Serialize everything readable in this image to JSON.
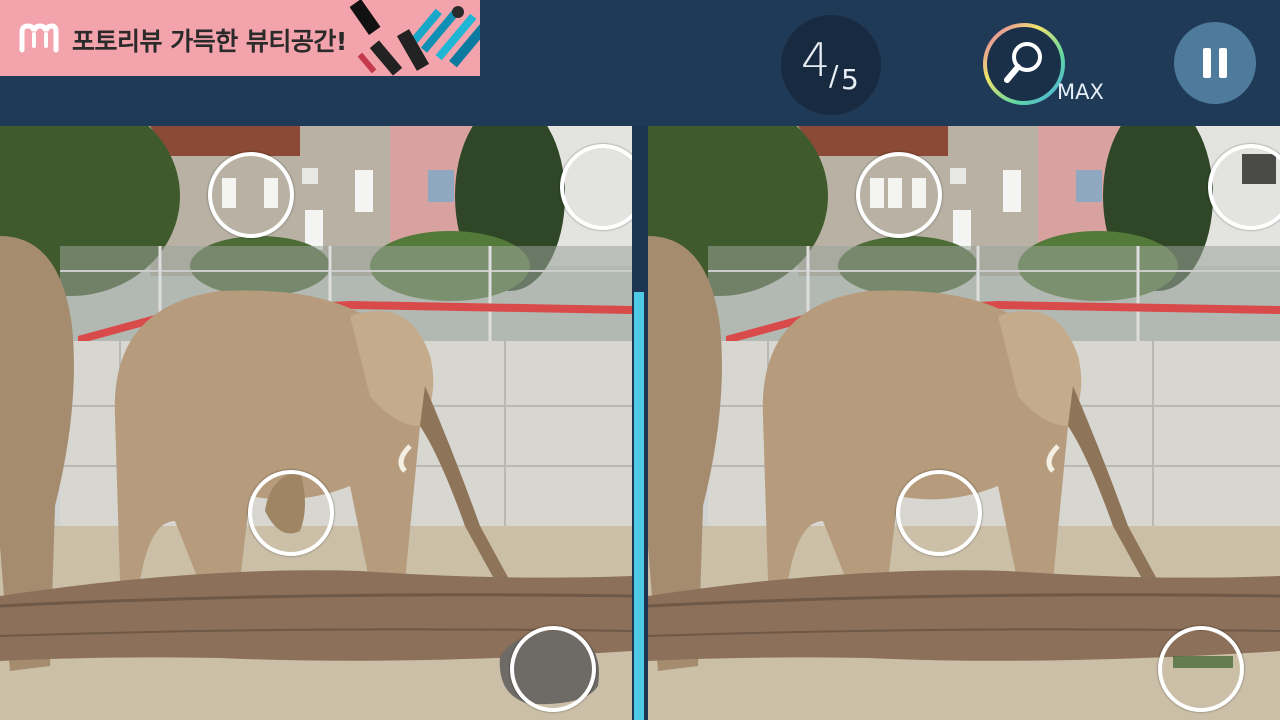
{
  "ad": {
    "text": "포토리뷰 가득한 뷰티공간!",
    "background": "#f3a3ab"
  },
  "counter": {
    "found": "4",
    "slash": "/",
    "total": "5"
  },
  "hint": {
    "label": "MAX",
    "icon": "magnifier-icon"
  },
  "pause": {
    "icon": "pause-icon"
  },
  "progress": {
    "fraction": 0.72,
    "color": "#4ec9e6"
  },
  "panels": [
    {
      "name": "left-image"
    },
    {
      "name": "right-image"
    }
  ],
  "colors": {
    "top_bar": "#1f3a57",
    "marker": "#ffffff",
    "pause_button": "#4e7a9b"
  }
}
